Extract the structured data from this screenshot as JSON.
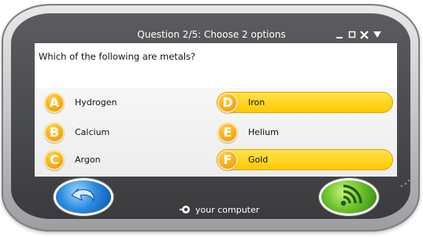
{
  "window": {
    "title": "Question 2/5: Choose 2 options",
    "controls": [
      "minimize-icon",
      "maximize-icon",
      "close-icon",
      "dropdown-icon"
    ]
  },
  "question": {
    "text": "Which of the following are metals?"
  },
  "options": [
    {
      "letter": "A",
      "label": "Hydrogen",
      "selected": false
    },
    {
      "letter": "B",
      "label": "Calcium",
      "selected": false
    },
    {
      "letter": "C",
      "label": "Argon",
      "selected": false
    },
    {
      "letter": "D",
      "label": "Iron",
      "selected": true
    },
    {
      "letter": "E",
      "label": "Helium",
      "selected": false
    },
    {
      "letter": "F",
      "label": "Gold",
      "selected": true
    }
  ],
  "footer": {
    "label": "your computer",
    "icon": "computer-icon"
  },
  "buttons": {
    "back_icon": "back-arrow-icon",
    "submit_icon": "wifi-icon"
  },
  "colors": {
    "selected_fill": "#ffcd00",
    "badge": "#f6a81a",
    "back_button": "#2a8be0",
    "submit_button": "#6cc32a"
  }
}
